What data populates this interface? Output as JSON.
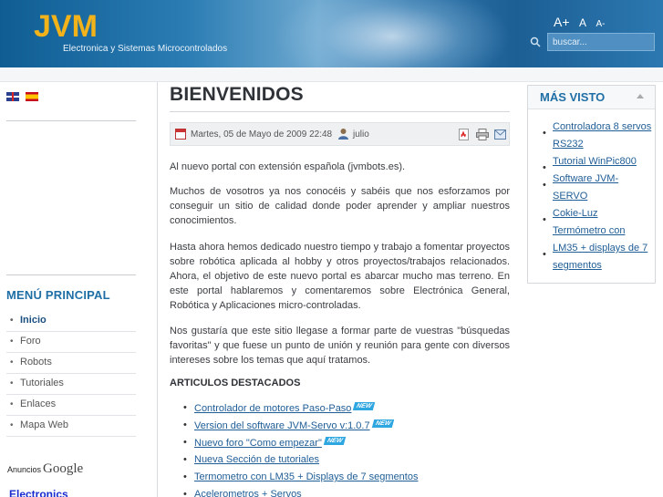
{
  "header": {
    "logo": "JVM",
    "tagline": "Electronica y Sistemas Microcontrolados",
    "font_size": {
      "large": "A+",
      "medium": "A",
      "small": "A-"
    },
    "search_placeholder": "buscar..."
  },
  "left": {
    "languages": [
      "English",
      "Español"
    ],
    "menu_title": "MENÚ PRINCIPAL",
    "menu_items": [
      "Inicio",
      "Foro",
      "Robots",
      "Tutoriales",
      "Enlaces",
      "Mapa Web"
    ],
    "active_item": "Inicio",
    "ads_label": "Anuncios",
    "ads_brand": "Google",
    "ads_link": "Electronics"
  },
  "article": {
    "title": "BIENVENIDOS",
    "date": "Martes, 05 de Mayo de 2009 22:48",
    "author": "julio",
    "paragraphs": [
      "Al nuevo portal con extensión española (jvmbots.es).",
      "Muchos de vosotros ya nos conocéis y sabéis que nos esforzamos por conseguir un sitio de calidad donde poder aprender y ampliar nuestros conocimientos.",
      "Hasta ahora hemos dedicado nuestro tiempo y trabajo a fomentar proyectos sobre robótica aplicada al hobby y otros proyectos/trabajos relacionados. Ahora, el objetivo de este nuevo portal es abarcar mucho mas terreno. En este portal hablaremos y comentaremos sobre Electrónica General, Robótica y Aplicaciones micro-controladas.",
      "Nos gustaría que este sitio llegase a formar parte de vuestras \"búsquedas favoritas\" y que fuese un punto de unión y reunión para gente con diversos intereses sobre los temas que aquí tratamos."
    ],
    "section_title": "ARTICULOS DESTACADOS",
    "featured": [
      {
        "label": "Controlador de motores Paso-Paso",
        "badge": "NEW"
      },
      {
        "label": "Version del software JVM-Servo v:1.0.7",
        "badge": "NEW"
      },
      {
        "label": "Nuevo foro \"Como empezar\"",
        "badge": "NEW"
      },
      {
        "label": "Nueva Sección de tutoriales",
        "badge": ""
      },
      {
        "label": "Termometro con LM35 + Displays de 7 segmentos",
        "badge": ""
      },
      {
        "label": "Acelerometros + Servos",
        "badge": ""
      }
    ]
  },
  "right": {
    "title": "MÁS VISTO",
    "items": [
      "Controladora 8 servos RS232",
      "Tutorial WinPic800",
      "Software JVM-SERVO",
      "Cokie-Luz Termómetro con",
      "LM35 + displays de 7 segmentos"
    ]
  }
}
